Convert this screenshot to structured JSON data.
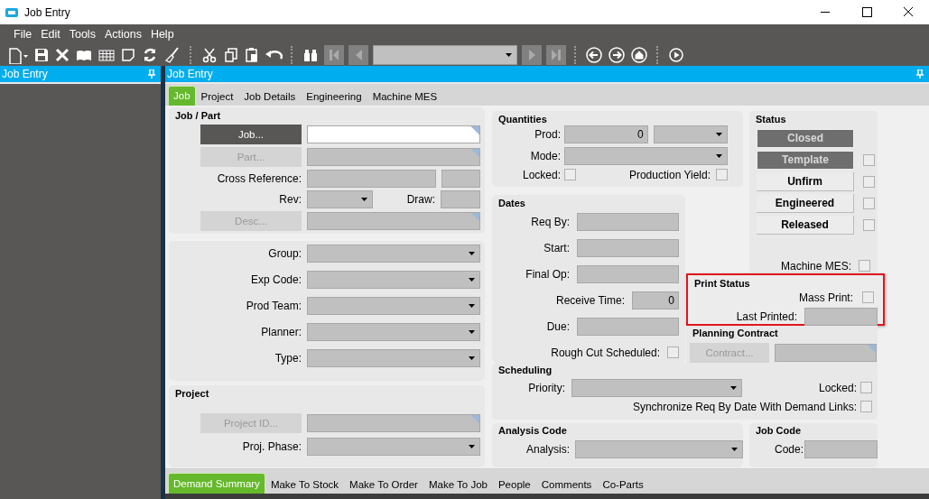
{
  "window": {
    "title": "Job Entry"
  },
  "menu": [
    "File",
    "Edit",
    "Tools",
    "Actions",
    "Help"
  ],
  "left_pane": {
    "title": "Job Entry"
  },
  "main_pane": {
    "title": "Job Entry"
  },
  "tabs": [
    {
      "label": "Job",
      "selected": true
    },
    {
      "label": "Project",
      "selected": false
    },
    {
      "label": "Job Details",
      "selected": false
    },
    {
      "label": "Engineering",
      "selected": false
    },
    {
      "label": "Machine MES",
      "selected": false
    }
  ],
  "job_part": {
    "title": "Job / Part",
    "job_button": {
      "label": "Job...",
      "disabled": false
    },
    "part_button": {
      "label": "Part...",
      "disabled": true
    },
    "cross_reference": {
      "label": "Cross Reference:"
    },
    "rev": {
      "label": "Rev:"
    },
    "draw": {
      "label": "Draw:"
    },
    "desc_button": {
      "label": "Desc...",
      "disabled": true
    }
  },
  "classification": {
    "fields": [
      {
        "label": "Group:"
      },
      {
        "label": "Exp Code:"
      },
      {
        "label": "Prod Team:"
      },
      {
        "label": "Planner:"
      },
      {
        "label": "Type:"
      }
    ]
  },
  "project": {
    "title": "Project",
    "project_button": {
      "label": "Project ID...",
      "disabled": true
    },
    "phase": {
      "label": "Proj. Phase:"
    }
  },
  "quantities": {
    "title": "Quantities",
    "prod": {
      "label": "Prod:",
      "value": "0"
    },
    "mode": {
      "label": "Mode:"
    },
    "locked": {
      "label": "Locked:",
      "checked": false
    },
    "production_yield": {
      "label": "Production Yield:",
      "checked": false
    }
  },
  "dates": {
    "title": "Dates",
    "fields": [
      {
        "kind": "date",
        "label": "Req By:"
      },
      {
        "kind": "date",
        "label": "Start:"
      },
      {
        "kind": "date",
        "label": "Final Op:"
      },
      {
        "kind": "number",
        "label": "Receive Time:",
        "value": "0"
      },
      {
        "kind": "date",
        "label": "Due:"
      },
      {
        "kind": "checkbox",
        "label": "Rough Cut Scheduled:",
        "checked": false
      }
    ]
  },
  "status": {
    "title": "Status",
    "buttons": [
      {
        "kind": "plain",
        "label": "Closed",
        "selected": true
      },
      {
        "kind": "with_checkbox",
        "label": "Template",
        "selected": true,
        "checked": false
      },
      {
        "kind": "with_checkbox",
        "label": "Unfirm",
        "selected": false,
        "checked": false
      },
      {
        "kind": "with_checkbox",
        "label": "Engineered",
        "selected": false,
        "checked": false
      },
      {
        "kind": "with_checkbox",
        "label": "Released",
        "selected": false,
        "checked": false
      }
    ],
    "machine_mes": {
      "label": "Machine MES:",
      "checked": false
    }
  },
  "print_status": {
    "title": "Print Status",
    "highlighted": true,
    "mass_print": {
      "label": "Mass Print:",
      "checked": false
    },
    "last_printed": {
      "label": "Last Printed:"
    }
  },
  "planning_contract": {
    "title": "Planning Contract",
    "contract_button": {
      "label": "Contract...",
      "disabled": true
    }
  },
  "scheduling": {
    "title": "Scheduling",
    "priority": {
      "label": "Priority:"
    },
    "locked": {
      "label": "Locked:",
      "checked": false
    },
    "synchronize": {
      "label": "Synchronize Req By Date With Demand Links:",
      "checked": false
    }
  },
  "analysis_code": {
    "title": "Analysis Code",
    "analysis": {
      "label": "Analysis:"
    }
  },
  "job_code": {
    "title": "Job Code",
    "code": {
      "label": "Code:"
    }
  },
  "bottom_tabs": [
    {
      "label": "Demand Summary",
      "selected": true
    },
    {
      "label": "Make To Stock",
      "selected": false
    },
    {
      "label": "Make To Order",
      "selected": false
    },
    {
      "label": "Make To Job",
      "selected": false
    },
    {
      "label": "People",
      "selected": false
    },
    {
      "label": "Comments",
      "selected": false
    },
    {
      "label": "Co-Parts",
      "selected": false
    }
  ]
}
